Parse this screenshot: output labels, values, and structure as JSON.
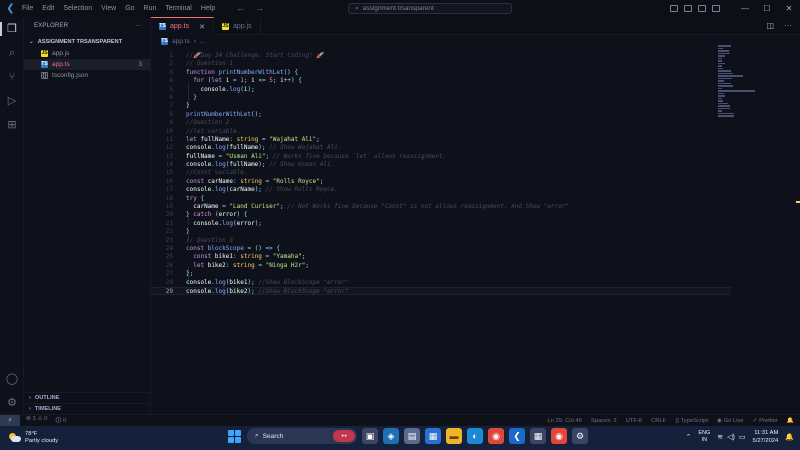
{
  "menu": [
    "File",
    "Edit",
    "Selection",
    "View",
    "Go",
    "Run",
    "Terminal",
    "Help"
  ],
  "command_center": "assignment trsansparent",
  "sidebar": {
    "title": "EXPLORER",
    "folder": "ASSIGNMENT TRSANSPARENT",
    "files": [
      {
        "name": "app.js",
        "type": "js",
        "badge": ""
      },
      {
        "name": "app.ts",
        "type": "ts",
        "badge": "3"
      },
      {
        "name": "tsconfig.json",
        "type": "json",
        "badge": ""
      }
    ],
    "outline": "OUTLINE",
    "timeline": "TIMELINE"
  },
  "tabs": [
    {
      "label": "app.ts",
      "type": "ts",
      "active": true
    },
    {
      "label": "app.js",
      "type": "js",
      "active": false
    }
  ],
  "breadcrumb": "app.ts",
  "code_lines": [
    {
      "n": "1",
      "html": "<span class='cm'>//🚀Day 34 Challenge: Start Coding! 🚀</span>"
    },
    {
      "n": "2",
      "html": "<span class='cm'>// Question 1</span>"
    },
    {
      "n": "3",
      "html": "<span class='kw'>function</span> <span class='fn'>printNumberWithLet</span><span class='op'>() {</span>"
    },
    {
      "n": "4",
      "html": "  <span class='kw'>for</span> <span class='op'>(</span><span class='kw'>let</span> <span class='vr'>i</span> <span class='op'>=</span> <span class='num'>1</span><span class='op'>;</span> <span class='vr'>i</span> <span class='op'>&lt;=</span> <span class='num'>5</span><span class='op'>;</span> <span class='vr'>i</span><span class='op'>++) {</span>"
    },
    {
      "n": "5",
      "html": "    <span class='vr'>console</span><span class='op'>.</span><span class='fn'>log</span><span class='op'>(</span><span class='vr'>i</span><span class='op'>);</span>"
    },
    {
      "n": "6",
      "html": "  <span class='op'>}</span>"
    },
    {
      "n": "7",
      "html": "<span class='op'>}</span>"
    },
    {
      "n": "8",
      "html": "<span class='fn'>printNumberWithLet</span><span class='op'>();</span>"
    },
    {
      "n": "9",
      "html": "<span class='cm'>//Question 2</span>"
    },
    {
      "n": "10",
      "html": "<span class='cm'>//let variable.</span>"
    },
    {
      "n": "11",
      "html": "<span class='kw'>let</span> <span class='vr'>fullName</span><span class='op'>:</span> <span class='ty'>string</span> <span class='op'>=</span> <span class='str'>\"Wajahat Ali\"</span><span class='op'>;</span>"
    },
    {
      "n": "12",
      "html": "<span class='vr'>console</span><span class='op'>.</span><span class='fn'>log</span><span class='op'>(</span><span class='vr'>fullName</span><span class='op'>);</span> <span class='cm'>// Show Wajahat Ali.</span>"
    },
    {
      "n": "13",
      "html": "<span class='vr'>fullName</span> <span class='op'>=</span> <span class='str'>\"Usman Ali\"</span><span class='op'>;</span> <span class='cm'>// Works fine because `let` allows reassignment.</span>"
    },
    {
      "n": "14",
      "html": "<span class='vr'>console</span><span class='op'>.</span><span class='fn'>log</span><span class='op'>(</span><span class='vr'>fullName</span><span class='op'>);</span> <span class='cm'>// Show Usman Ali.</span>"
    },
    {
      "n": "15",
      "html": "<span class='cm'>//Const variable.</span>"
    },
    {
      "n": "16",
      "html": "<span class='kw'>const</span> <span class='vr'>carName</span><span class='op'>:</span> <span class='ty'>string</span> <span class='op'>=</span> <span class='str'>\"Rolls Royce\"</span><span class='op'>;</span>"
    },
    {
      "n": "17",
      "html": "<span class='vr'>console</span><span class='op'>.</span><span class='fn'>log</span><span class='op'>(</span><span class='vr'>carName</span><span class='op'>);</span> <span class='cm'>// Show Rolls Royce.</span>"
    },
    {
      "n": "18",
      "html": "<span class='kw'>try</span> <span class='op'>{</span>"
    },
    {
      "n": "19",
      "html": "  <span class='vr'>carName</span> <span class='op'>=</span> <span class='str'>\"Land Curiser\"</span><span class='op'>;</span> <span class='cm'>// Not Works fine because \"Const\" is not allows reassignment. And Show \"error\"</span>"
    },
    {
      "n": "20",
      "html": "<span class='op'>}</span> <span class='kw'>catch</span> <span class='op'>(</span><span class='vr'>error</span><span class='op'>) {</span>"
    },
    {
      "n": "21",
      "html": "  <span class='vr'>console</span><span class='op'>.</span><span class='fn'>log</span><span class='op'>(</span><span class='vr'>error</span><span class='op'>);</span>"
    },
    {
      "n": "22",
      "html": "<span class='op'>}</span>"
    },
    {
      "n": "23",
      "html": "<span class='cm'>// Question 3</span>"
    },
    {
      "n": "24",
      "html": "<span class='kw'>const</span> <span class='fn'>blockScope</span> <span class='op'>= () =&gt; {</span>"
    },
    {
      "n": "25",
      "html": "  <span class='kw'>const</span> <span class='vr'>bike1</span><span class='op'>:</span> <span class='ty'>string</span> <span class='op'>=</span> <span class='str'>\"Yamaha\"</span><span class='op'>;</span>"
    },
    {
      "n": "26",
      "html": "  <span class='kw'>let</span> <span class='vr'>bike2</span><span class='op'>:</span> <span class='ty'>string</span> <span class='op'>=</span> <span class='str'>\"Ninga H2r\"</span><span class='op'>;</span>"
    },
    {
      "n": "27",
      "html": "<span class='op'>};</span>"
    },
    {
      "n": "28",
      "html": "<span class='vr'>console</span><span class='op'>.</span><span class='fn'>log</span><span class='op'>(</span><span class='vr'>bike1</span><span class='op'>);</span> <span class='cm'>//Show BlockScope \"error\"</span>"
    },
    {
      "n": "29",
      "html": "<span class='vr'>console</span><span class='op'>.</span><span class='fn'>log</span><span class='op'>(</span><span class='vr'>bike2</span><span class='op'>);</span> <span class='cm'>//Show BlockScope \"error\"</span>"
    }
  ],
  "current_line": "29",
  "statusbar": {
    "errors": "3",
    "warnings": "0",
    "infos": "0",
    "position": "Ln 29, Col 46",
    "spaces": "Spaces: 2",
    "encoding": "UTF-8",
    "eol": "CRLF",
    "language": "TypeScript",
    "golive": "Go Live",
    "prettier": "Prettier"
  },
  "taskbar": {
    "temp": "78°F",
    "weather": "Partly cloudy",
    "search": "Search",
    "lang1": "ENG",
    "lang2": "IN",
    "time": "11:31 AM",
    "date": "5/27/2024"
  }
}
